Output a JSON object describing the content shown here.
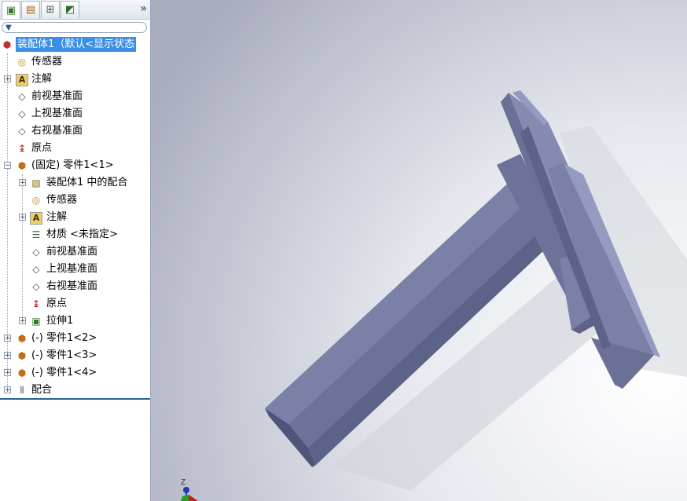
{
  "tabs": [
    {
      "name": "featuremanager",
      "icon": "feature-tree-icon"
    },
    {
      "name": "propertymanager",
      "icon": "property-icon"
    },
    {
      "name": "configurationmanager",
      "icon": "configuration-icon"
    },
    {
      "name": "displaymanager",
      "icon": "display-icon"
    }
  ],
  "expand_label": "»",
  "filter_label": "▼",
  "tree": {
    "root": "装配体1（默认<显示状态",
    "sensors": "传感器",
    "annotations": "注解",
    "front_plane": "前视基准面",
    "top_plane": "上视基准面",
    "right_plane": "右视基准面",
    "origin": "原点",
    "part1_1": "(固定) 零件1<1>",
    "part1_1_children": {
      "mates_in": "装配体1 中的配合",
      "sensors": "传感器",
      "annotations": "注解",
      "material": "材质 <未指定>",
      "front_plane": "前视基准面",
      "top_plane": "上视基准面",
      "right_plane": "右视基准面",
      "origin": "原点",
      "extrude": "拉伸1"
    },
    "part1_2": "(-) 零件1<2>",
    "part1_3": "(-) 零件1<3>",
    "part1_4": "(-) 零件1<4>",
    "mates": "配合"
  },
  "triad_label": "Z",
  "colors": {
    "selection": "#3c8fe6",
    "steel_face": "#7a80a6",
    "steel_dark": "#5c6288",
    "steel_light": "#959ac0"
  }
}
